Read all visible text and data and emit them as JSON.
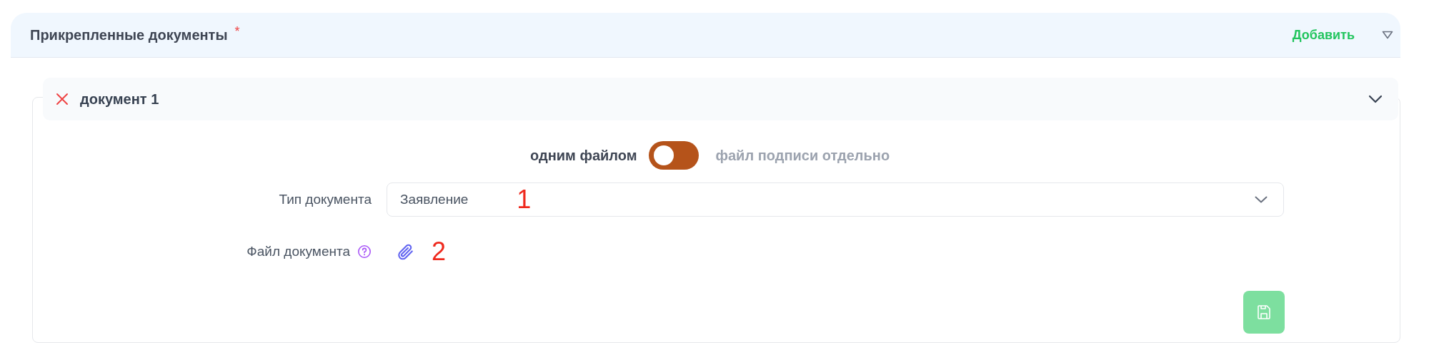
{
  "section": {
    "title": "Прикрепленные документы",
    "required_mark": "*",
    "add_link": "Добавить",
    "expanded": true
  },
  "document": {
    "title": "документ 1",
    "expanded": true,
    "mode_toggle": {
      "left_label": "одним файлом",
      "right_label": "файл подписи отдельно",
      "on": false
    },
    "fields": [
      {
        "kind": "select",
        "label": "Тип документа",
        "value": "Заявление",
        "annotation": "1"
      },
      {
        "kind": "file",
        "label": "Файл документа",
        "annotation": "2"
      }
    ]
  }
}
